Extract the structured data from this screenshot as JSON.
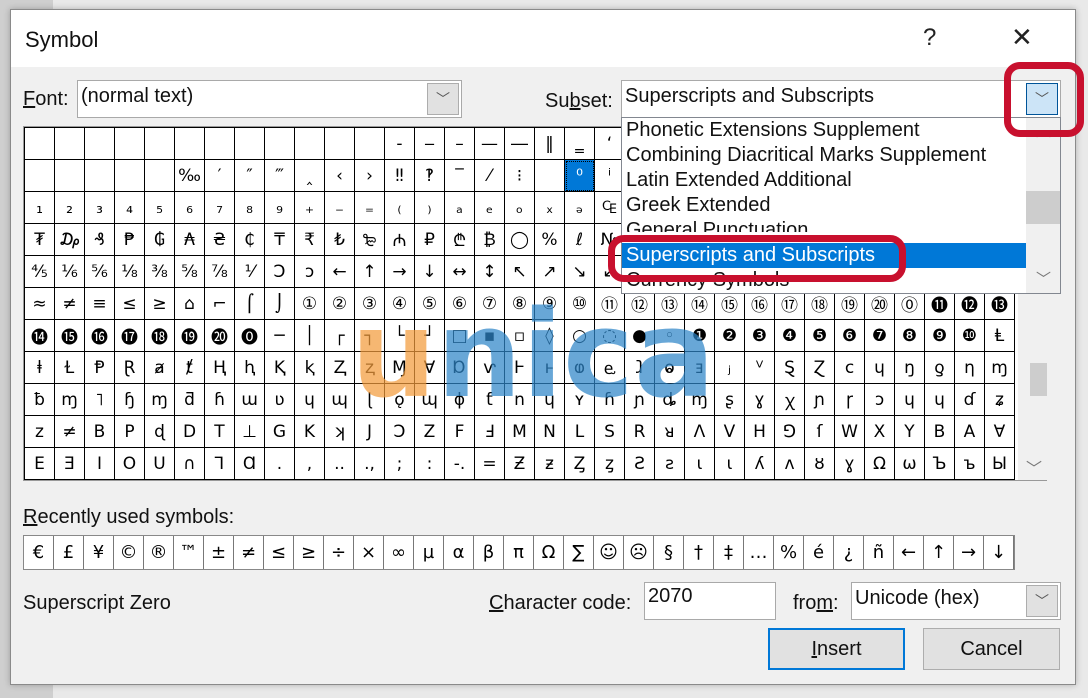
{
  "dialog": {
    "title": "Symbol",
    "help": "?",
    "close": "✕"
  },
  "font": {
    "label_u": "F",
    "label_rest": "ont:",
    "value": "(normal text)"
  },
  "subset": {
    "label_a": "Su",
    "label_u": "b",
    "label_b": "set:",
    "value": "Superscripts and Subscripts",
    "options": [
      "Phonetic Extensions Supplement",
      "Combining Diacritical Marks Supplement",
      "Latin Extended Additional",
      "Greek Extended",
      "General Punctuation",
      "Superscripts and Subscripts",
      "Currency Symbols"
    ],
    "selected_index": 5
  },
  "grid": {
    "selected": {
      "row": 1,
      "col": 18
    },
    "rows": [
      [
        "",
        "",
        "",
        "",
        "",
        "",
        "",
        "",
        "",
        "",
        "",
        "",
        "‐",
        "‒",
        "–",
        "—",
        "―",
        "‖",
        "‗",
        "‘",
        "",
        "",
        "",
        "",
        "",
        "",
        "",
        "",
        "",
        "",
        "",
        "",
        ""
      ],
      [
        "",
        "",
        "",
        "",
        "",
        "‰",
        "′",
        "″",
        "‴",
        "‸",
        "‹",
        "›",
        "‼",
        "‽",
        "‾",
        "⁄",
        "⁝",
        "",
        "⁰",
        "ⁱ",
        "",
        "",
        "",
        "",
        "",
        "",
        "",
        "",
        "",
        "",
        "",
        "",
        ""
      ],
      [
        "₁",
        "₂",
        "₃",
        "₄",
        "₅",
        "₆",
        "₇",
        "₈",
        "₉",
        "₊",
        "₋",
        "₌",
        "₍",
        "₎",
        "ₐ",
        "ₑ",
        "ₒ",
        "ₓ",
        "ₔ",
        "₠",
        "",
        "",
        "",
        "",
        "",
        "",
        "",
        "",
        "",
        "",
        "",
        "",
        ""
      ],
      [
        "₮",
        "₯",
        "₰",
        "₱",
        "₲",
        "₳",
        "₴",
        "₵",
        "₸",
        "₹",
        "₺",
        "₻",
        "₼",
        "₽",
        "₾",
        "₿",
        "◯",
        "%",
        "ℓ",
        "№",
        "",
        "",
        "",
        "",
        "",
        "",
        "",
        "",
        "",
        "",
        "",
        "",
        ""
      ],
      [
        "⅘",
        "⅙",
        "⅚",
        "⅛",
        "⅜",
        "⅝",
        "⅞",
        "⅟",
        "Ↄ",
        "ↄ",
        "←",
        "↑",
        "→",
        "↓",
        "↔",
        "↕",
        "↖",
        "↗",
        "↘",
        "↙",
        "",
        "",
        "",
        "",
        "",
        "",
        "",
        "",
        "",
        "",
        "",
        "",
        ""
      ],
      [
        "≈",
        "≠",
        "≡",
        "≤",
        "≥",
        "⌂",
        "⌐",
        "⌠",
        "⌡",
        "①",
        "②",
        "③",
        "④",
        "⑤",
        "⑥",
        "⑦",
        "⑧",
        "⑨",
        "⑩",
        "⑪",
        "⑫",
        "⑬",
        "⑭",
        "⑮",
        "⑯",
        "⑰",
        "⑱",
        "⑲",
        "⑳",
        "⓪",
        "⓫",
        "⓬",
        "⓭"
      ],
      [
        "⓮",
        "⓯",
        "⓰",
        "⓱",
        "⓲",
        "⓳",
        "⓴",
        "⓿",
        "─",
        "│",
        "┌",
        "┐",
        "└",
        "┘",
        "□",
        "▪",
        "▫",
        "◊",
        "○",
        "◌",
        "●",
        "◦",
        "❶",
        "❷",
        "❸",
        "❹",
        "❺",
        "❻",
        "❼",
        "❽",
        "❾",
        "❿",
        "Ⱡ"
      ],
      [
        "ⱡ",
        "Ɫ",
        "Ᵽ",
        "Ɽ",
        "ⱥ",
        "ⱦ",
        "Ⱨ",
        "ⱨ",
        "Ⱪ",
        "ⱪ",
        "Ⱬ",
        "ⱬ",
        "Ɱ",
        "Ɐ",
        "Ɒ",
        "ⱱ",
        "Ⱶ",
        "ⱶ",
        "ⱷ",
        "ⱸ",
        "ⱹ",
        "ⱺ",
        "ⱻ",
        "ⱼ",
        "ⱽ",
        "Ȿ",
        "Ɀ",
        "ᴄ",
        "ɥ",
        "ŋ",
        "ƍ",
        "η",
        "ɱ"
      ],
      [
        "ƀ",
        "ɱ",
        "˥",
        "ɧ",
        "ɱ",
        "ƌ",
        "ɦ",
        "ɯ",
        "ʋ",
        "ɥ",
        "ɰ",
        "ɭ",
        "ǫ",
        "ɰ",
        "ɸ",
        "ƭ",
        "n",
        "ɥ",
        "ʏ",
        "ɦ",
        "ɲ",
        "ȡ",
        "ɱ",
        "ʂ",
        "ɣ",
        "ꭓ",
        "ɲ",
        "ɼ",
        "ɔ",
        "ɥ",
        "ɥ",
        "ɗ",
        "ʑ"
      ],
      [
        "z",
        "≠",
        "B",
        "P",
        "ɖ",
        "D",
        "T",
        "⊥",
        "G",
        "K",
        "ʞ",
        "J",
        "Ↄ",
        "Z",
        "F",
        "Ⅎ",
        "M",
        "N",
        "L",
        "S",
        "R",
        "ᴚ",
        "Λ",
        "V",
        "H",
        "⅁",
        "ſ",
        "W",
        "X",
        "Y",
        "B",
        "A",
        "∀"
      ],
      [
        "E",
        "Ǝ",
        "I",
        "O",
        "U",
        "∩",
        "⅂",
        "Ɑ",
        ".",
        ",",
        "..",
        ".,",
        ";",
        ":",
        "-.",
        "=",
        "Ƶ",
        "ƶ",
        "Ȥ",
        "ȥ",
        "Ƨ",
        "ƨ",
        "ɩ",
        "ι",
        "ʎ",
        "ʌ",
        "ȣ",
        "ɣ",
        "Ω",
        "ω",
        "Ъ",
        "ъ",
        "Ы"
      ]
    ]
  },
  "recent": {
    "label_u": "R",
    "label_rest": "ecently used symbols:",
    "symbols": [
      "€",
      "£",
      "¥",
      "©",
      "®",
      "™",
      "±",
      "≠",
      "≤",
      "≥",
      "÷",
      "×",
      "∞",
      "µ",
      "α",
      "β",
      "π",
      "Ω",
      "∑",
      "☺",
      "☹",
      "§",
      "†",
      "‡",
      "…",
      "%",
      "é",
      "¿",
      "ñ",
      "←",
      "↑",
      "→",
      "↓"
    ]
  },
  "status": {
    "char_name": "Superscript Zero"
  },
  "charcode": {
    "label_u": "C",
    "label_rest": "haracter code:",
    "value": "2070"
  },
  "from": {
    "label_a": "fro",
    "label_u": "m",
    "label_b": ":",
    "value": "Unicode (hex)"
  },
  "buttons": {
    "insert_u": "I",
    "insert_rest": "nsert",
    "cancel": "Cancel"
  },
  "watermark": {
    "part1": "u",
    "part2": "nica",
    "color1": "#f39c3c",
    "color2": "#2f86c8"
  },
  "colors": {
    "selection": "#0078d7",
    "highlight": "#c8102e"
  }
}
